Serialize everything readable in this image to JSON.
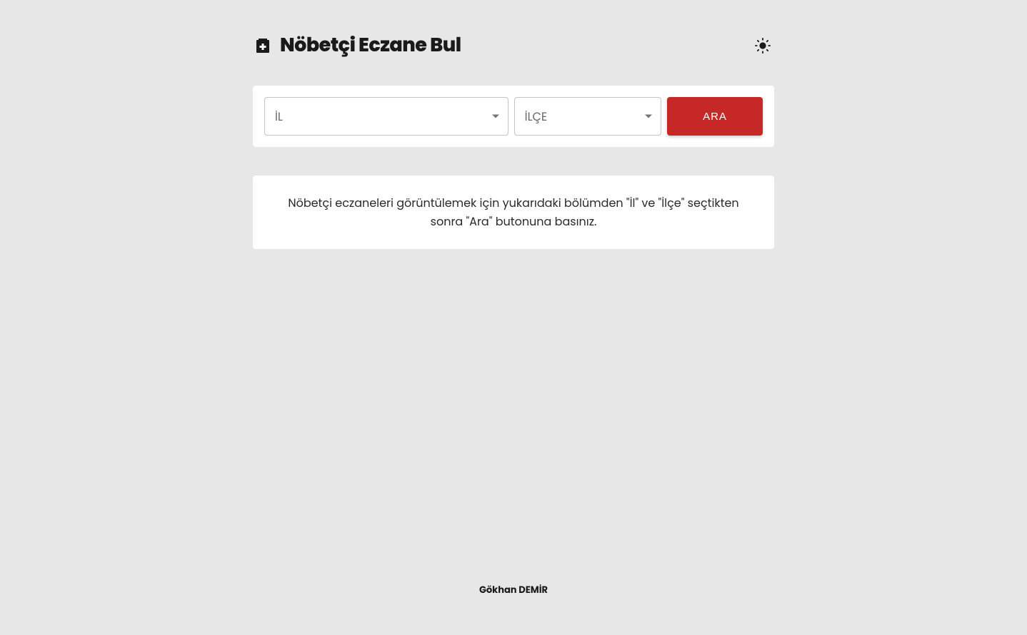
{
  "header": {
    "title": "Nöbetçi Eczane Bul"
  },
  "search": {
    "province_label": "İL",
    "district_label": "İLÇE",
    "search_button_label": "ARA"
  },
  "info": {
    "message": "Nöbetçi eczaneleri görüntülemek için yukarıdaki bölümden \"İl\" ve \"İlçe\" seçtikten sonra \"Ara\" butonuna basınız."
  },
  "footer": {
    "author": "Gökhan DEMİR"
  },
  "colors": {
    "background": "#e7e7e7",
    "card": "#ffffff",
    "primary_button": "#c62828",
    "text": "#1a1a1a"
  }
}
